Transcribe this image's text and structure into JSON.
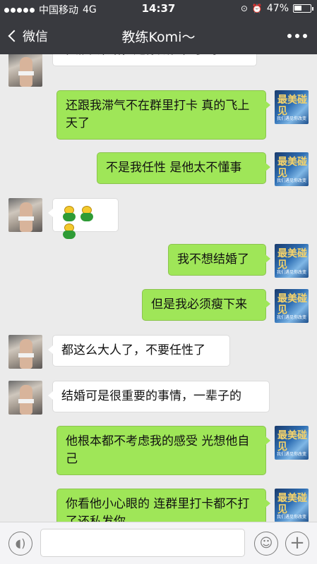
{
  "status_bar": {
    "carrier": "中国移动",
    "network": "4G",
    "time": "14:37",
    "battery": "47%",
    "battery_level": 0.47
  },
  "nav": {
    "back_label": "微信",
    "title": "教练Komi～"
  },
  "avatars": {
    "right_text": "最美碰见",
    "right_sub": "我们遇见你改变"
  },
  "messages": [
    {
      "side": "left",
      "text": "干嘛吵架哈，是你太任性了吗？"
    },
    {
      "side": "right",
      "text": "还跟我滞气不在群里打卡 真的飞上天了"
    },
    {
      "side": "right",
      "text": "不是我任性 是他太不懂事"
    },
    {
      "side": "left",
      "text": "",
      "emoji_count": 3,
      "emoji_icon": "pig-emoji-icon"
    },
    {
      "side": "right",
      "text": "我不想结婚了"
    },
    {
      "side": "right",
      "text": "但是我必须瘦下来"
    },
    {
      "side": "left",
      "text": "都这么大人了，不要任性了"
    },
    {
      "side": "left",
      "text": "结婚可是很重要的事情，一辈子的"
    },
    {
      "side": "right",
      "text": "他根本都不考虑我的感受 光想他自己"
    },
    {
      "side": "right",
      "text": "你看他小心眼的 连群里打卡都不打了还私发你"
    }
  ],
  "input_bar": {
    "voice_icon": "voice-icon",
    "emoji_icon": "smile-icon",
    "more_icon": "plus-icon",
    "text_value": ""
  },
  "colors": {
    "nav_bg": "#393a3f",
    "chat_bg": "#ebebeb",
    "bubble_sent": "#9fe658",
    "bubble_received": "#ffffff"
  }
}
